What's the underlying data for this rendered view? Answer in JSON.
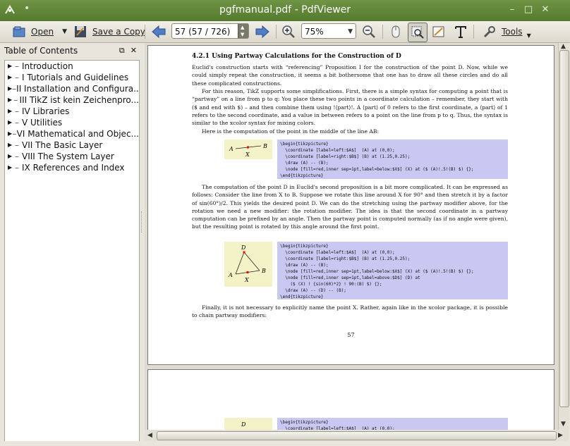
{
  "window": {
    "title": "pgfmanual.pdf - PdfViewer"
  },
  "toolbar": {
    "open_label": "Open",
    "save_copy_label": "Save a Copy",
    "page_entry": "57 (57 / 726)",
    "zoom_value": "75%",
    "tools_label": "Tools"
  },
  "sidebar": {
    "title": "Table of Contents",
    "items": [
      {
        "label": "Introduction"
      },
      {
        "label": "I Tutorials and Guidelines"
      },
      {
        "label": "II Installation and Configura..."
      },
      {
        "label": "III TikZ ist kein Zeichenpro..."
      },
      {
        "label": "IV Libraries"
      },
      {
        "label": "V Utilities"
      },
      {
        "label": "VI Mathematical and Objec..."
      },
      {
        "label": "VII The Basic Layer"
      },
      {
        "label": "VIII The System Layer"
      },
      {
        "label": "IX References and Index"
      }
    ]
  },
  "document": {
    "heading": "4.2.1   Using Partway Calculations for the Construction of D",
    "para1": "Euclid's construction starts with “referencing” Proposition I for the construction of the point D. Now, while we could simply repeat the construction, it seems a bit bothersome that one has to draw all these circles and do all these complicated constructions.",
    "para2": "For this reason, TikZ supports some simplifications. First, there is a simple syntax for computing a point that is “partway” on a line from p to q: You place these two points in a coordinate calculation – remember, they start with ($ and end with $) – and then combine them using !⟨part⟩!. A ⟨part⟩ of 0 refers to the first coordinate, a ⟨part⟩ of 1 refers to the second coordinate, and a value in between refers to a point on the line from p to q. Thus, the syntax is similar to the xcolor syntax for mixing colors.",
    "para3": "Here is the computation of the point in the middle of the line AB:",
    "code1": "\\begin{tikzpicture}\n  \\coordinate [label=left:$A$]  (A) at (0,0);\n  \\coordinate [label=right:$B$] (B) at (1.25,0.25);\n  \\draw (A) -- (B);\n  \\node [fill=red,inner sep=1pt,label=below:$X$] (X) at ($ (A)!.5!(B) $) {};\n\\end{tikzpicture}",
    "para4": "The computation of the point D in Euclid's second proposition is a bit more complicated. It can be expressed as follows: Consider the line from X to B. Suppose we rotate this line around X for 90° and then stretch it by a factor of sin(60°)/2. This yields the desired point D. We can do the stretching using the partway modifier above, for the rotation we need a new modifier: the rotation modifier. The idea is that the second coordinate in a partway computation can be prefixed by an angle. Then the partway point is computed normally (as if no angle were given), but the resulting point is rotated by this angle around the first point.",
    "code2": "\\begin{tikzpicture}\n  \\coordinate [label=left:$A$]  (A) at (0,0);\n  \\coordinate [label=right:$B$] (B) at (1.25,0.25);\n  \\draw (A) -- (B);\n  \\node [fill=red,inner sep=1pt,label=below:$X$] (X) at ($ (A)!.5!(B) $) {};\n  \\node [fill=red,inner sep=1pt,label=above:$D$] (D) at\n    ($ (X) ! {sin(60)*2} ! 90:(B) $) {};\n  \\draw (A) -- (D) -- (B);\n\\end{tikzpicture}",
    "para5": "Finally, it is not necessary to explicitly name the point X. Rather, again like in the xcolor package, it is possible to chain partway modifiers:",
    "page_number": "57",
    "code3": "\\begin{tikzpicture}\n  \\coordinate [label=left:$A$]  (A) at (0,0);",
    "fig_labels": {
      "a": "A",
      "b": "B",
      "x": "X",
      "d": "D"
    }
  },
  "colors": {
    "titlebar": "#5f8637",
    "code_bg": "#c8c8f2",
    "figure_bg": "#f4f3c8"
  }
}
